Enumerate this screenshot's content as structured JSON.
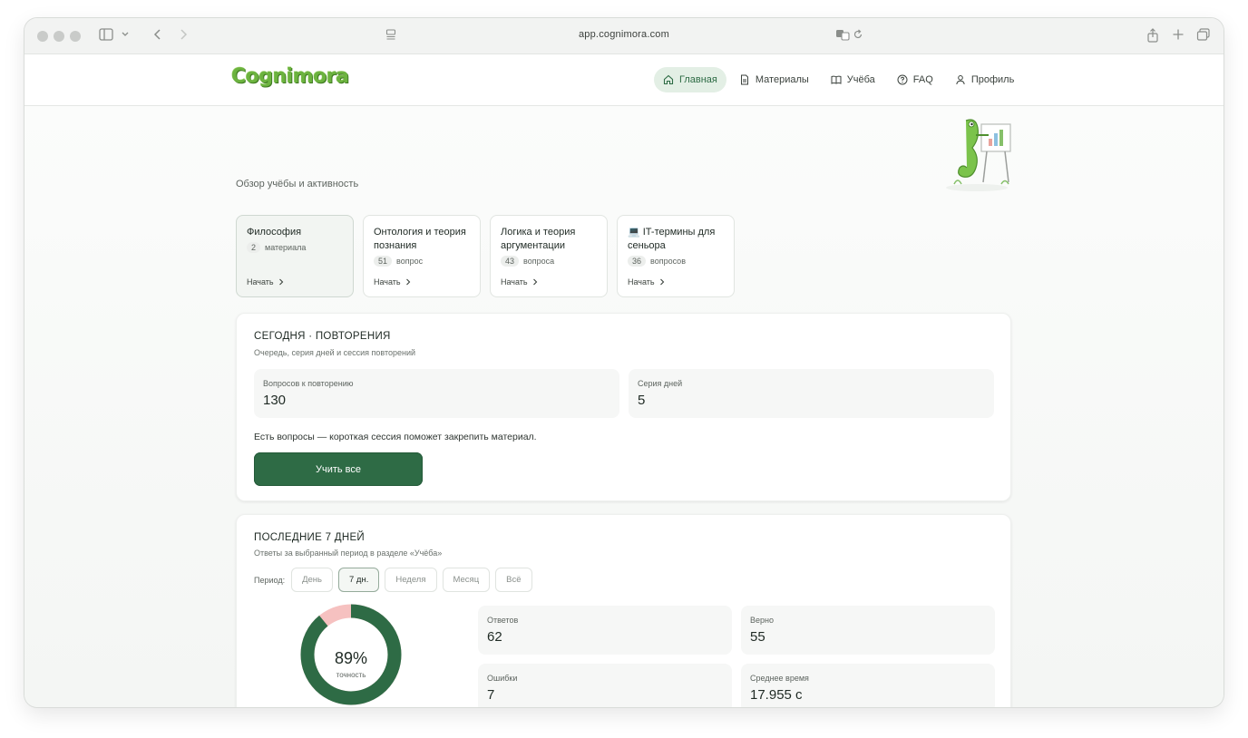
{
  "browser": {
    "url": "app.cognimora.com"
  },
  "app": {
    "logo": "Cognimora",
    "nav": [
      {
        "label": "Главная",
        "icon": "home-icon",
        "active": true
      },
      {
        "label": "Материалы",
        "icon": "document-icon",
        "active": false
      },
      {
        "label": "Учёба",
        "icon": "book-icon",
        "active": false
      },
      {
        "label": "FAQ",
        "icon": "help-icon",
        "active": false
      },
      {
        "label": "Профиль",
        "icon": "user-icon",
        "active": false
      }
    ]
  },
  "page": {
    "subtitle": "Обзор учёбы и активность",
    "categories": [
      {
        "title": "Философия",
        "count": "2",
        "unit": "материала",
        "start": "Начать",
        "active": true
      },
      {
        "title": "Онтология и теория познания",
        "count": "51",
        "unit": "вопрос",
        "start": "Начать",
        "active": false
      },
      {
        "title": "Логика и теория аргументации",
        "count": "43",
        "unit": "вопроса",
        "start": "Начать",
        "active": false
      },
      {
        "title": "💻 IT-термины для сеньора",
        "count": "36",
        "unit": "вопросов",
        "start": "Начать",
        "active": false
      }
    ]
  },
  "today": {
    "title": "СЕГОДНЯ · ПОВТОРЕНИЯ",
    "subtitle": "Очередь, серия дней и сессия повторений",
    "review_label": "Вопросов к повторению",
    "review_value": "130",
    "streak_label": "Серия дней",
    "streak_value": "5",
    "message": "Есть вопросы — короткая сессия поможет закрепить материал.",
    "button": "Учить все"
  },
  "last7": {
    "title": "ПОСЛЕДНИЕ 7 ДНЕЙ",
    "subtitle": "Ответы за выбранный период в разделе «Учёба»",
    "period_label": "Период:",
    "periods": [
      "День",
      "7 дн.",
      "Неделя",
      "Месяц",
      "Всё"
    ],
    "active_period": "7 дн.",
    "accuracy_value": "89%",
    "accuracy_label": "точность",
    "accuracy_fraction": 0.89,
    "colors": {
      "correct": "#2e6b45",
      "wrong": "#f6c1c0"
    },
    "stats": [
      {
        "label": "Ответов",
        "value": "62"
      },
      {
        "label": "Верно",
        "value": "55"
      },
      {
        "label": "Ошибки",
        "value": "7"
      },
      {
        "label": "Среднее время",
        "value": "17.955 с"
      }
    ]
  }
}
